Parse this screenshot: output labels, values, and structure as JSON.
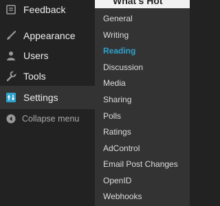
{
  "header": {
    "title_peek": "What's Hot"
  },
  "menu": {
    "items": [
      {
        "label": "Feedback",
        "icon": "feedback-icon"
      },
      {
        "label": "Appearance",
        "icon": "paintbrush-icon"
      },
      {
        "label": "Users",
        "icon": "users-icon"
      },
      {
        "label": "Tools",
        "icon": "wrench-icon"
      },
      {
        "label": "Settings",
        "icon": "settings-icon",
        "current": true
      }
    ],
    "collapse_label": "Collapse menu"
  },
  "submenu": {
    "items": [
      "General",
      "Writing",
      "Reading",
      "Discussion",
      "Media",
      "Sharing",
      "Polls",
      "Ratings",
      "AdControl",
      "Email Post Changes",
      "OpenID",
      "Webhooks"
    ],
    "active": "Reading"
  },
  "colors": {
    "menu_bg": "#222222",
    "current_bg": "#333333",
    "accent": "#2ea2cc",
    "text": "#eeeeee"
  }
}
